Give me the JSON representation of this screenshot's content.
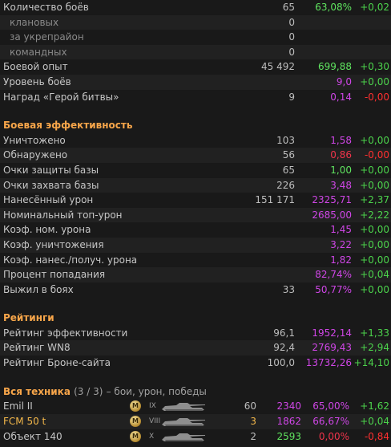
{
  "colors": {
    "section_title": "#f8a64a",
    "green_pct": "#5fe35f",
    "red_pct": "#f0344b",
    "purple_pct": "#cf46e6",
    "green_delta": "#4cd34c",
    "red_delta": "#ff3030",
    "highlight": "#f3b74a"
  },
  "general": [
    {
      "label": "Количество боёв",
      "value": "65",
      "pct": "63,08%",
      "pct_color": "green",
      "delta": "+0,02",
      "delta_color": "green"
    },
    {
      "label": "клановых",
      "value": "0",
      "indent": true
    },
    {
      "label": "за укрепрайон",
      "value": "0",
      "indent": true
    },
    {
      "label": "командных",
      "value": "0",
      "indent": true
    },
    {
      "label": "Боевой опыт",
      "value": "45 492",
      "pct": "699,88",
      "pct_color": "green",
      "delta": "+0,30",
      "delta_color": "green"
    },
    {
      "label": "Уровень боёв",
      "value": "",
      "pct": "9,0",
      "pct_color": "purple",
      "delta": "+0,00",
      "delta_color": "green"
    },
    {
      "label": "Наград «Герой битвы»",
      "value": "9",
      "pct": "0,14",
      "pct_color": "purple",
      "delta": "-0,00",
      "delta_color": "red"
    }
  ],
  "efficiency": {
    "title": "Боевая эффективность",
    "rows": [
      {
        "label": "Уничтожено",
        "value": "103",
        "pct": "1,58",
        "pct_color": "purple",
        "delta": "+0,00",
        "delta_color": "green"
      },
      {
        "label": "Обнаружено",
        "value": "56",
        "pct": "0,86",
        "pct_color": "red",
        "delta": "-0,00",
        "delta_color": "red"
      },
      {
        "label": "Очки защиты базы",
        "value": "65",
        "pct": "1,00",
        "pct_color": "green",
        "delta": "+0,00",
        "delta_color": "green"
      },
      {
        "label": "Очки захвата базы",
        "value": "226",
        "pct": "3,48",
        "pct_color": "purple",
        "delta": "+0,00",
        "delta_color": "green"
      },
      {
        "label": "Нанесённый урон",
        "value": "151 171",
        "pct": "2325,71",
        "pct_color": "purple",
        "delta": "+2,37",
        "delta_color": "green"
      },
      {
        "label": "Номинальный топ-урон",
        "value": "",
        "pct": "2685,00",
        "pct_color": "purple",
        "delta": "+2,22",
        "delta_color": "green"
      },
      {
        "label": "Коэф. ном. урона",
        "value": "",
        "pct": "1,45",
        "pct_color": "purple",
        "delta": "+0,00",
        "delta_color": "green"
      },
      {
        "label": "Коэф. уничтожения",
        "value": "",
        "pct": "3,22",
        "pct_color": "purple",
        "delta": "+0,00",
        "delta_color": "green"
      },
      {
        "label": "Коэф. нанес./получ. урона",
        "value": "",
        "pct": "1,82",
        "pct_color": "purple",
        "delta": "+0,00",
        "delta_color": "green"
      },
      {
        "label": "Процент попадания",
        "value": "",
        "pct": "82,74%",
        "pct_color": "purple",
        "delta": "+0,04",
        "delta_color": "green"
      },
      {
        "label": "Выжил в боях",
        "value": "33",
        "pct": "50,77%",
        "pct_color": "purple",
        "delta": "+0,00",
        "delta_color": "green"
      }
    ]
  },
  "ratings": {
    "title": "Рейтинги",
    "rows": [
      {
        "label": "Рейтинг эффективности",
        "value": "96,1",
        "pct": "1952,14",
        "pct_color": "purple",
        "delta": "+1,33",
        "delta_color": "green"
      },
      {
        "label": "Рейтинг WN8",
        "value": "92,4",
        "pct": "2769,43",
        "pct_color": "purple",
        "delta": "+2,94",
        "delta_color": "green"
      },
      {
        "label": "Рейтинг Броне-сайта",
        "value": "100,0",
        "pct": "13732,26",
        "pct_color": "purple",
        "delta": "+14,10",
        "delta_color": "green"
      }
    ]
  },
  "vehicles": {
    "title": "Вся техника",
    "count": "(3 / 3)",
    "subtitle": "– бои, урон, победы",
    "rows": [
      {
        "name": "Emil II",
        "mark": "M",
        "tier": "IX",
        "battles": "60",
        "battles_color": "normal",
        "damage": "2340",
        "damage_color": "purple",
        "win": "65,00%",
        "win_color": "purple",
        "delta": "+1,62",
        "delta_color": "green",
        "highlight": false
      },
      {
        "name": "FCM 50 t",
        "mark": "M",
        "tier": "VIII",
        "battles": "3",
        "battles_color": "highlight",
        "damage": "1862",
        "damage_color": "purple",
        "win": "66,67%",
        "win_color": "purple",
        "delta": "+0,04",
        "delta_color": "green",
        "highlight": true
      },
      {
        "name": "Объект 140",
        "mark": "M",
        "tier": "X",
        "battles": "2",
        "battles_color": "normal",
        "damage": "2593",
        "damage_color": "green",
        "win": "0,00%",
        "win_color": "red",
        "delta": "-0,84",
        "delta_color": "red",
        "highlight": false
      }
    ]
  }
}
